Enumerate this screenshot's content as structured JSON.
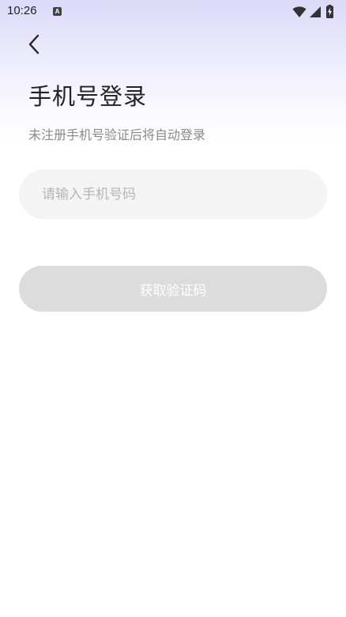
{
  "status_bar": {
    "time": "10:26",
    "app_icon_letter": "A",
    "icons": [
      "wifi-icon",
      "signal-icon",
      "battery-charging-icon"
    ]
  },
  "header": {
    "back_icon": "chevron-left-icon"
  },
  "main": {
    "title": "手机号登录",
    "subtitle": "未注册手机号验证后将自动登录",
    "phone_input": {
      "value": "",
      "placeholder": "请输入手机号码"
    },
    "get_code_label": "获取验证码"
  },
  "colors": {
    "gradient_top": "#dcdaf8",
    "input_bg": "#f4f4f4",
    "button_disabled_bg": "#dcdcdc",
    "title_text": "#222222",
    "subtitle_text": "#8a8a8a"
  }
}
